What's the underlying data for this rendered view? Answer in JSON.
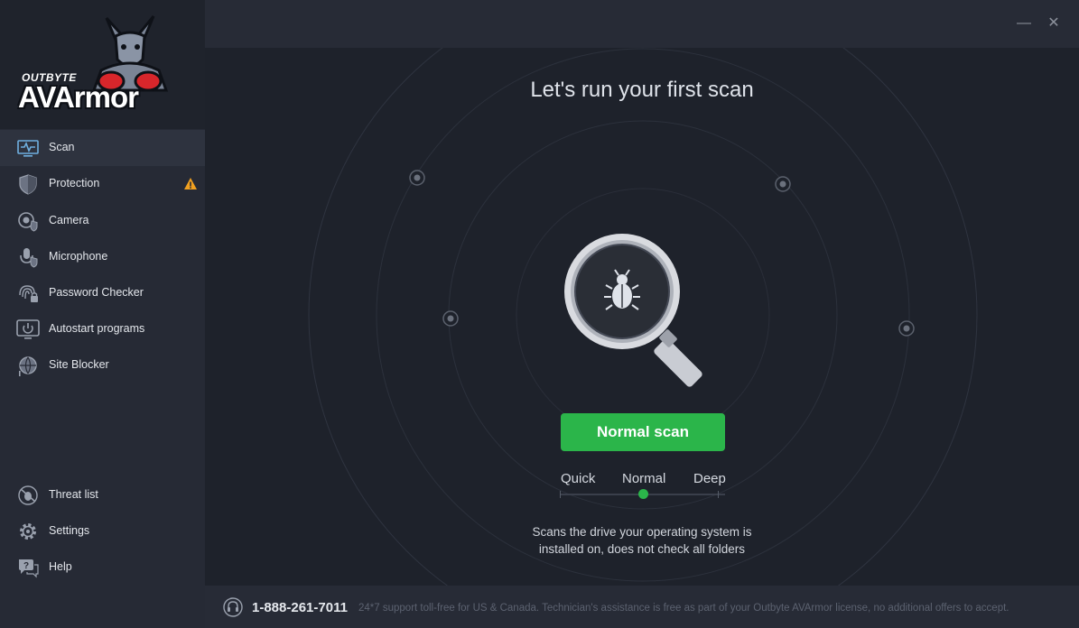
{
  "logo": {
    "brand_small": "OUTBYTE",
    "brand_big": "AVArmor"
  },
  "window": {
    "minimize": "—",
    "close": "✕"
  },
  "sidebar": {
    "items": [
      {
        "label": "Scan",
        "icon": "monitor-pulse-icon",
        "active": true
      },
      {
        "label": "Protection",
        "icon": "shield-icon",
        "warning": true
      },
      {
        "label": "Camera",
        "icon": "camera-shield-icon"
      },
      {
        "label": "Microphone",
        "icon": "microphone-shield-icon"
      },
      {
        "label": "Password Checker",
        "icon": "fingerprint-lock-icon"
      },
      {
        "label": "Autostart programs",
        "icon": "power-monitor-icon"
      },
      {
        "label": "Site Blocker",
        "icon": "globe-block-icon"
      }
    ],
    "bottom": [
      {
        "label": "Threat list",
        "icon": "bug-circle-icon"
      },
      {
        "label": "Settings",
        "icon": "gear-icon"
      },
      {
        "label": "Help",
        "icon": "help-bubble-icon"
      }
    ]
  },
  "main": {
    "title": "Let's run your first scan",
    "scan_button": "Normal scan",
    "modes": [
      "Quick",
      "Normal",
      "Deep"
    ],
    "selected_mode": "Normal",
    "description": [
      "Scans the drive your operating system is",
      "installed on, does not check all folders"
    ]
  },
  "footer": {
    "phone": "1-888-261-7011",
    "note": "24*7 support toll-free for US & Canada. Technician's assistance is free as part of your Outbyte AVArmor license, no additional offers to accept."
  },
  "colors": {
    "accent": "#2bb54a",
    "warning": "#f0a020",
    "sidebar_bg": "#262a35",
    "main_bg": "#1e222b"
  }
}
